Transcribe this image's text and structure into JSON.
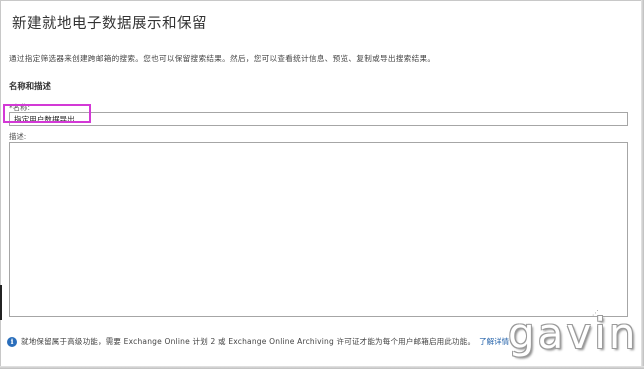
{
  "dialog": {
    "title": "新建就地电子数据展示和保留",
    "intro": "通过指定筛选器来创建跨邮箱的搜索。您也可以保留搜索结果。然后，您可以查看统计信息、预览、复制或导出搜索结果。"
  },
  "section": {
    "heading": "名称和描述"
  },
  "form": {
    "name_label": "*名称:",
    "name_value": "指定用户数据导出",
    "description_label": "描述:",
    "description_value": ""
  },
  "info_bar": {
    "icon": "info-icon",
    "text": "就地保留属于高级功能，需要 Exchange Online 计划 2 或 Exchange Online Archiving 许可证才能为每个用户邮箱启用此功能。",
    "link": "了解详情"
  },
  "watermark": {
    "text": "gavin"
  },
  "colors": {
    "highlight": "#d339d6",
    "link": "#1f5fa8",
    "info_icon": "#2a6ebb"
  }
}
